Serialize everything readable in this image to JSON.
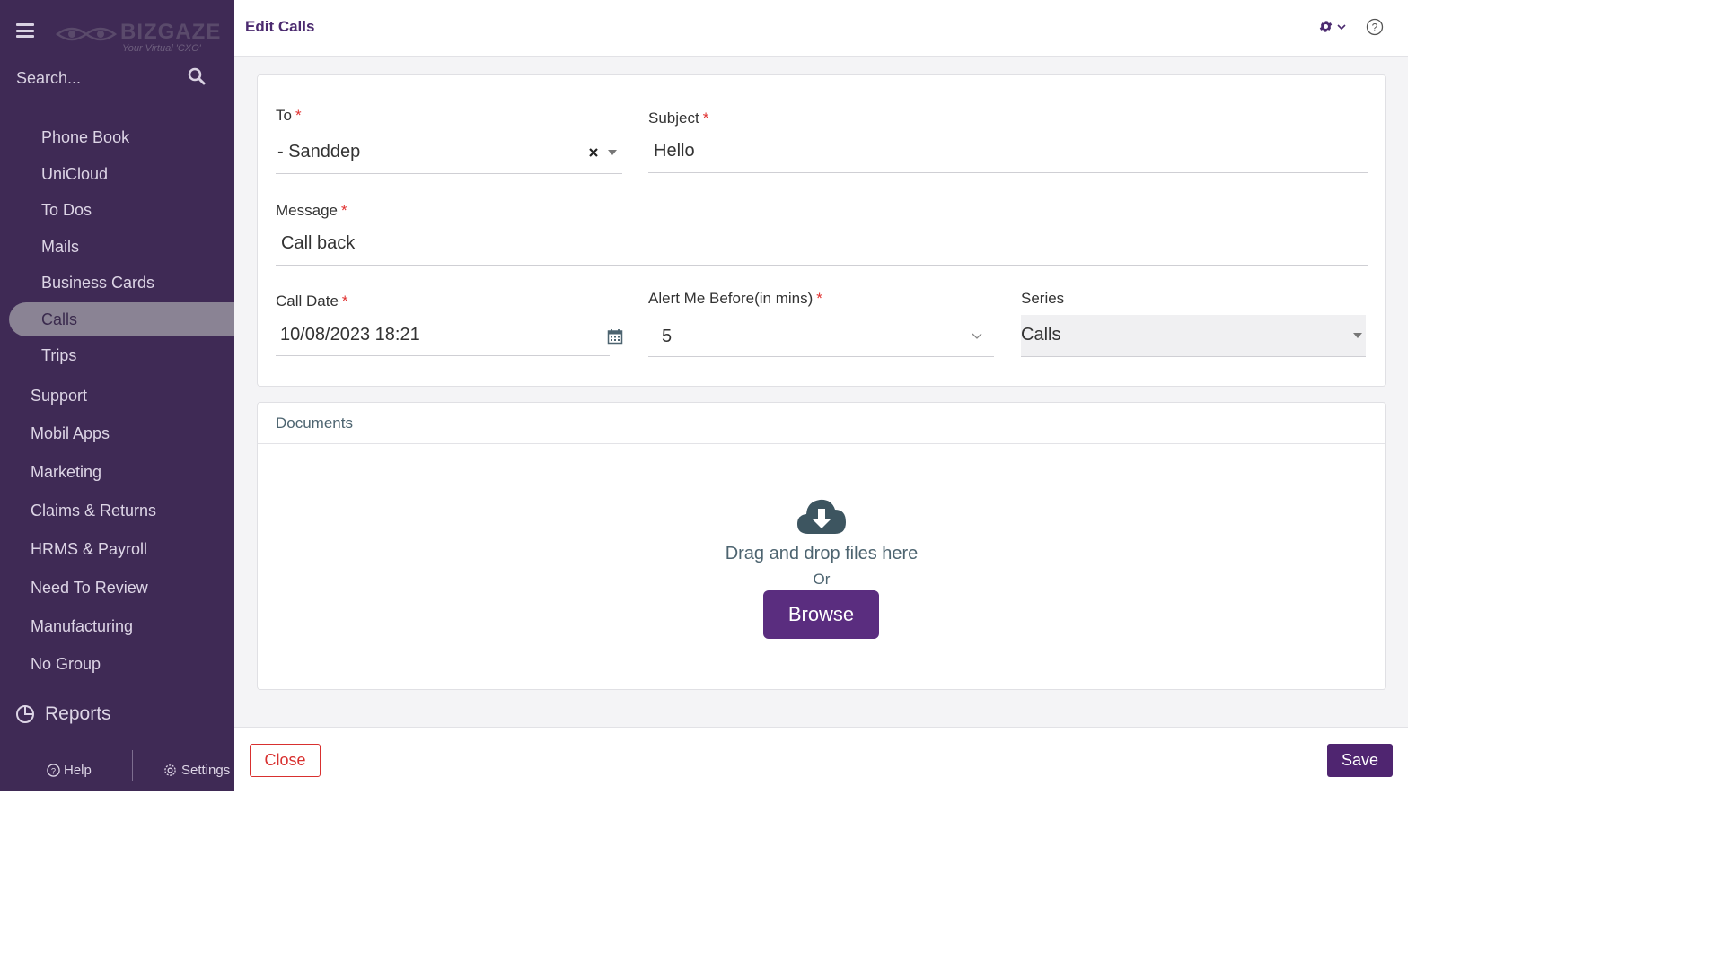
{
  "app": {
    "brand": "BIZGAZE",
    "tagline": "Your Virtual 'CXO'"
  },
  "sidebar": {
    "search_placeholder": "Search...",
    "sub_items": [
      {
        "label": "Phone Book"
      },
      {
        "label": "UniCloud"
      },
      {
        "label": "To Dos"
      },
      {
        "label": "Mails"
      },
      {
        "label": "Business Cards"
      },
      {
        "label": "Calls",
        "active": true
      },
      {
        "label": "Trips"
      }
    ],
    "groups": [
      {
        "label": "Support"
      },
      {
        "label": "Mobil Apps"
      },
      {
        "label": "Marketing"
      },
      {
        "label": "Claims & Returns"
      },
      {
        "label": "HRMS & Payroll"
      },
      {
        "label": "Need To Review"
      },
      {
        "label": "Manufacturing"
      },
      {
        "label": "No Group"
      }
    ],
    "reports_label": "Reports",
    "help_label": "Help",
    "settings_label": "Settings"
  },
  "header": {
    "title": "Edit Calls"
  },
  "form": {
    "to": {
      "label": "To",
      "value": "- Sanddep",
      "required": "*"
    },
    "subject": {
      "label": "Subject",
      "value": "Hello",
      "required": "*"
    },
    "message": {
      "label": "Message",
      "value": "Call back",
      "required": "*"
    },
    "call_date": {
      "label": "Call Date",
      "value": "10/08/2023 18:21",
      "required": "*"
    },
    "alert": {
      "label": "Alert Me Before(in mins)",
      "value": "5",
      "required": "*"
    },
    "series": {
      "label": "Series",
      "value": "Calls"
    }
  },
  "documents": {
    "title": "Documents",
    "drop_text": "Drag and drop files here",
    "or_text": "Or",
    "browse_label": "Browse"
  },
  "footer": {
    "close_label": "Close",
    "save_label": "Save"
  },
  "colors": {
    "sidebar_bg": "#3f2a55",
    "primary": "#4f2570",
    "danger": "#d8302f",
    "required": "#e0302f"
  }
}
